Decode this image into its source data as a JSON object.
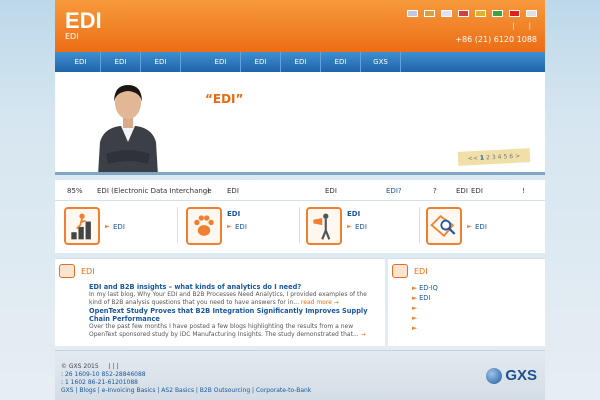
{
  "header": {
    "logo": "EDI",
    "tagline": "EDI",
    "tools": [
      "|",
      "|"
    ],
    "phone": "+86 (21) 6120 1088",
    "flags": [
      {
        "name": "uk-flag-icon",
        "color": "#c0c8e0"
      },
      {
        "name": "de-flag-icon",
        "color": "#d8a040"
      },
      {
        "name": "fr-flag-icon",
        "color": "#e0e0ff"
      },
      {
        "name": "nl-flag-icon",
        "color": "#d04040"
      },
      {
        "name": "es-flag-icon",
        "color": "#e0b030"
      },
      {
        "name": "br-flag-icon",
        "color": "#40a040"
      },
      {
        "name": "cn-flag-icon",
        "color": "#e02020"
      },
      {
        "name": "kr-flag-icon",
        "color": "#e0e0e0"
      }
    ]
  },
  "nav": {
    "items": [
      "EDI",
      "EDI",
      "EDI",
      "EDI",
      "EDI",
      "EDI",
      "EDI",
      "GXS"
    ]
  },
  "banner": {
    "title": "“EDI”",
    "pager": [
      "<<",
      "1",
      "2",
      "3",
      "4",
      "5",
      "6",
      ">"
    ]
  },
  "info_strip": {
    "pct": "85%",
    "edi_def": "EDI (Electronic Data Interchange",
    "paren": ")",
    "edi_a": "EDI",
    "edi_b": "EDI",
    "edi_q": "EDI?",
    "q": "?",
    "edi_c": "EDI",
    "edi_d": "EDI",
    "bang": "!"
  },
  "features": [
    {
      "icon": "climbing-figure-icon",
      "title": "",
      "link": "EDI"
    },
    {
      "icon": "paw-print-icon",
      "title": "EDI",
      "link": "EDI"
    },
    {
      "icon": "megaphone-figure-icon",
      "title": "EDI",
      "link": "EDI"
    },
    {
      "icon": "magnifier-diagram-icon",
      "title": "",
      "link": "EDI"
    }
  ],
  "blog": {
    "title": "EDI",
    "posts": [
      {
        "title": "EDI and B2B insights – what kinds of analytics do I need?",
        "text": "In my last blog, Why Your EDI and B2B Processes Need Analytics, I provided examples of the kind of B2B analysis questions that you need to have answers for  in...",
        "more": "read more →"
      },
      {
        "title": "OpenText Study Proves that B2B Integration Significantly Improves Supply Chain Performance",
        "text": "Over the past few months I have posted a few blogs highlighting the results from a new OpenText sponsored study by IDC Manufacturing Insights. The study demonstrated that...",
        "more": "→"
      }
    ]
  },
  "right_panel": {
    "title": "EDI",
    "links": [
      "ED-IQ",
      "EDI",
      "",
      "",
      ""
    ]
  },
  "footer": {
    "copyright": "© GXS 2015",
    "copyright_sep": "|      |      |",
    "line2_label": ":",
    "line2": "26  1609-10  852-28846088",
    "line3_label": ":",
    "line3": "1 1602  86-21-61201088",
    "links_label": "GXS",
    "links": "| Blogs | e-Invoicing Basics | AS2 Basics | B2B Outsourcing | Corporate-to-Bank",
    "brand": "GXS"
  }
}
